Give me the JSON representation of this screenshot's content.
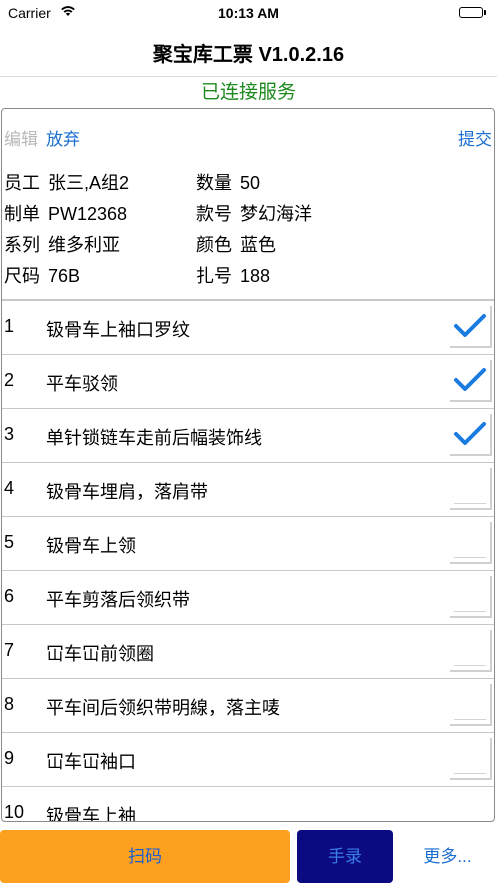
{
  "status_bar": {
    "carrier": "Carrier",
    "wifi_icon": "wifi-icon",
    "time": "10:13 AM",
    "battery_icon": "battery-icon",
    "battery_level": 1.0
  },
  "nav": {
    "title": "聚宝库工票 V1.0.2.16"
  },
  "connection": {
    "status": "已连接服务",
    "color": "#1e8a1e"
  },
  "toolbar": {
    "edit_label": "编辑",
    "discard_label": "放弃",
    "submit_label": "提交"
  },
  "info": {
    "employee_label": "员工",
    "employee_value": "张三,A组2",
    "quantity_label": "数量",
    "quantity_value": "50",
    "order_label": "制单",
    "order_value": "PW12368",
    "style_label": "款号",
    "style_value": "梦幻海洋",
    "series_label": "系列",
    "series_value": "维多利亚",
    "color_label": "颜色",
    "color_value": "蓝色",
    "size_label": "尺码",
    "size_value": "76B",
    "bundle_label": "扎号",
    "bundle_value": "188"
  },
  "process_list": [
    {
      "num": "1",
      "label": "钑骨车上袖口罗纹",
      "checked": true
    },
    {
      "num": "2",
      "label": "平车驳领",
      "checked": true
    },
    {
      "num": "3",
      "label": "单针锁链车走前后幅装饰线",
      "checked": true
    },
    {
      "num": "4",
      "label": "钑骨车埋肩，落肩带",
      "checked": false
    },
    {
      "num": "5",
      "label": "钑骨车上领",
      "checked": false
    },
    {
      "num": "6",
      "label": "平车剪落后领织带",
      "checked": false
    },
    {
      "num": "7",
      "label": "冚车冚前领圈",
      "checked": false
    },
    {
      "num": "8",
      "label": "平车间后领织带明線，落主唛",
      "checked": false
    },
    {
      "num": "9",
      "label": "冚车冚袖口",
      "checked": false
    },
    {
      "num": "10",
      "label": "钑骨车上袖",
      "checked": false
    }
  ],
  "bottom_bar": {
    "scan_label": "扫码",
    "manual_label": "手录",
    "more_label": "更多..."
  },
  "colors": {
    "accent_blue": "#1a6fd1",
    "check_blue": "#1a7be0",
    "scan_orange": "#fea01f",
    "manual_navy": "#0b0a80"
  }
}
